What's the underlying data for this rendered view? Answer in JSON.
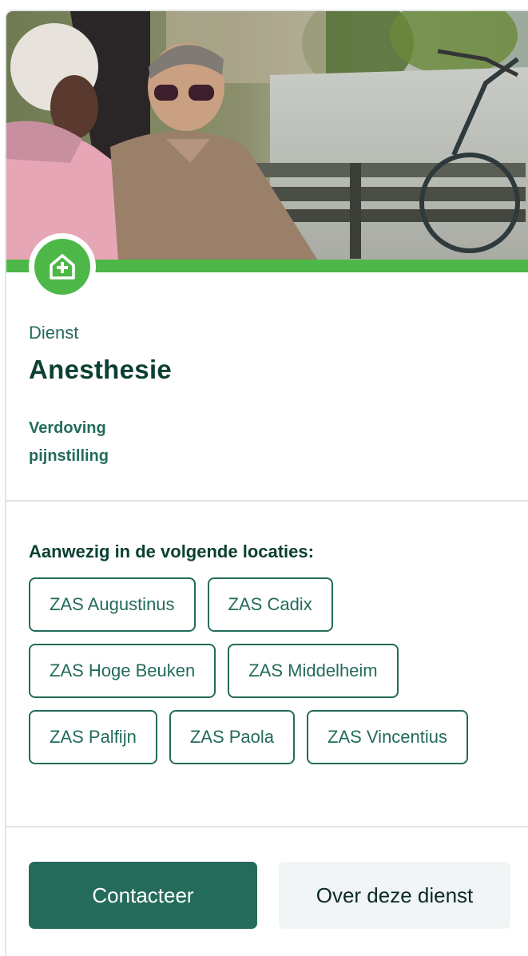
{
  "service": {
    "category_label": "Dienst",
    "name": "Anesthesie",
    "keywords": [
      "Verdoving",
      "pijnstilling"
    ],
    "icon": "hospital-home-icon"
  },
  "hero": {
    "image_description_icon": "photo-two-men-on-bench"
  },
  "locations": {
    "heading": "Aanwezig in de volgende locaties:",
    "items": [
      "ZAS Augustinus",
      "ZAS Cadix",
      "ZAS Hoge Beuken",
      "ZAS Middelheim",
      "ZAS Palfijn",
      "ZAS Paola",
      "ZAS Vincentius"
    ]
  },
  "actions": {
    "contact_label": "Contacteer",
    "about_label": "Over deze dienst"
  },
  "colors": {
    "brand_green": "#4db848",
    "dark_green": "#256b5b",
    "heading_green": "#0b4033"
  }
}
